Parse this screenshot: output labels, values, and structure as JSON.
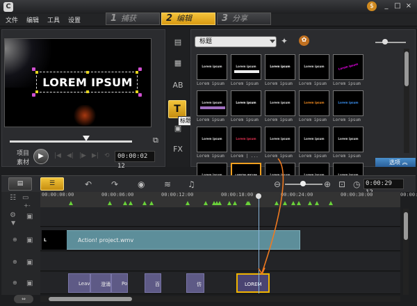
{
  "app": {
    "logo_text": "C",
    "badge": "$"
  },
  "window_controls": {
    "minimize": "_",
    "maximize": "□",
    "close": "×"
  },
  "menu": [
    "文件",
    "编辑",
    "工具",
    "设置"
  ],
  "steps": [
    {
      "num": "1",
      "label": "捕获"
    },
    {
      "num": "2",
      "label": "编辑"
    },
    {
      "num": "3",
      "label": "分享"
    }
  ],
  "active_step": 1,
  "player": {
    "title_text": "LOREM IPSUM",
    "mode_project": "项目",
    "mode_clip": "素材",
    "timecode": "00:00:02 12",
    "scrub_position": 0.6
  },
  "library": {
    "category": "标题",
    "tooltip": "标题",
    "thumbnails": [
      {
        "t": "Lorem ipsum",
        "c": "Lorem ipsum"
      },
      {
        "t": "Lorem ipsum",
        "c": "Lorem ipsum"
      },
      {
        "t": "Lorem ipsum",
        "c": "Lorem ipsum"
      },
      {
        "t": "Lorem ipsum",
        "c": "Lorem ipsum"
      },
      {
        "t": "Lorem ipsum",
        "c": "Lorem ipsum"
      },
      {
        "t": "Lorem ipsum",
        "c": "Lorem ipsum"
      },
      {
        "t": "Lorem ipsum",
        "c": "Lorem ipsum"
      },
      {
        "t": "Lorem ipsum",
        "c": "Lorem ipsum"
      },
      {
        "t": "Lorem ipsum",
        "c": "Lorem ipsum"
      },
      {
        "t": "Lorem ipsum",
        "c": "Lorem ipsum"
      },
      {
        "t": "Lorem ipsum",
        "c": "Lorem ipsum"
      },
      {
        "t": "Lorem ipsum",
        "c": "Lorem | ..."
      },
      {
        "t": "Lorem ipsum",
        "c": "Lorem ipsum"
      },
      {
        "t": "Lorem ipsum",
        "c": "Lorem ipsum"
      },
      {
        "t": "Lorem ipsum",
        "c": "Lorem ipsum"
      },
      {
        "t": "Lorem ipsum",
        "c": "Lorem | ..."
      },
      {
        "t": "LOREM IPSUM",
        "c": "LOREM IPSUM"
      },
      {
        "t": "Lorem ipsum",
        "c": "LOREM IP..."
      },
      {
        "t": "Lorem ipsum",
        "c": "Lorem IP..."
      },
      {
        "t": "Lorem ipsum",
        "c": "Lorem ipsum"
      }
    ],
    "selected_index": 16,
    "options_label": "选项"
  },
  "timeline": {
    "timecode": "0:00:29 12",
    "ruler": [
      "00:00:00:00",
      "00:00:06:00",
      "00:00:12:00",
      "00:00:18:00",
      "00:00:24:00",
      "00:00:30:00",
      "00:00:36:00"
    ],
    "video_clip": "Action! project.wmv",
    "title_clips": [
      "Leav",
      "澄涌",
      "Po",
      "百",
      "仿"
    ],
    "selected_title_clip": "LOREM"
  },
  "colors": {
    "accent": "#f0b400",
    "video_clip": "#5d8e9a",
    "title_clip": "#5e5a86",
    "selection": "#f0a020",
    "markers": "#6ad23a"
  }
}
